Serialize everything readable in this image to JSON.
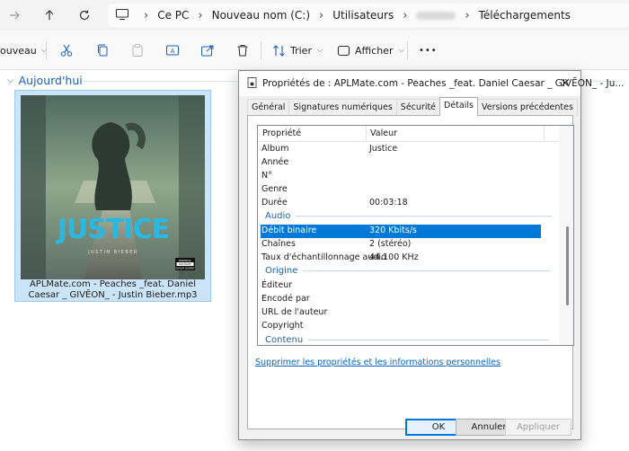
{
  "address_bar": {
    "breadcrumbs": [
      "Ce PC",
      "Nouveau nom (C:)",
      "Utilisateurs",
      "",
      "Téléchargements"
    ]
  },
  "toolbar": {
    "new_label": "ouveau",
    "sort_label": "Trier",
    "view_label": "Afficher",
    "more_label": "•••"
  },
  "content": {
    "group_label": "Aujourd'hui",
    "file_name": "APLMate.com - Peaches _feat. Daniel Caesar _ GIVĒON_ - Justin Bieber.mp3",
    "cover": {
      "title_art": "JUSTICE",
      "artist": "JUSTIN BIEBER",
      "advisory_line1": "PARENTAL",
      "advisory_line2": "ADVISORY",
      "advisory_line3": "EXPLICIT CONTENT"
    }
  },
  "dialog": {
    "title": "Propriétés de : APLMate.com - Peaches _feat. Daniel Caesar _ GIVĒON_ - Ju...",
    "tabs": [
      "Général",
      "Signatures numériques",
      "Sécurité",
      "Détails",
      "Versions précédentes"
    ],
    "active_tab": "Détails",
    "columns": {
      "property": "Propriété",
      "value": "Valeur"
    },
    "rows_media": [
      {
        "k": "Album",
        "v": "Justice"
      },
      {
        "k": "Année",
        "v": ""
      },
      {
        "k": "N°",
        "v": ""
      },
      {
        "k": "Genre",
        "v": ""
      },
      {
        "k": "Durée",
        "v": "00:03:18"
      }
    ],
    "section_audio": "Audio",
    "rows_audio": [
      {
        "k": "Débit binaire",
        "v": "320 Kbits/s"
      },
      {
        "k": "Chaînes",
        "v": "2 (stéréo)"
      },
      {
        "k": "Taux d'échantillonnage audio",
        "v": "44.100 KHz"
      }
    ],
    "section_origin": "Origine",
    "rows_origin": [
      {
        "k": "Éditeur",
        "v": ""
      },
      {
        "k": "Encodé par",
        "v": ""
      },
      {
        "k": "URL de l'auteur",
        "v": ""
      },
      {
        "k": "Copyright",
        "v": ""
      }
    ],
    "section_content": "Contenu",
    "remove_link": "Supprimer les propriétés et les informations personnelles",
    "buttons": {
      "ok": "OK",
      "cancel": "Annuler",
      "apply": "Appliquer"
    }
  },
  "colors": {
    "accent": "#0078d7",
    "link": "#0066cc",
    "section": "#1a5fb4"
  }
}
